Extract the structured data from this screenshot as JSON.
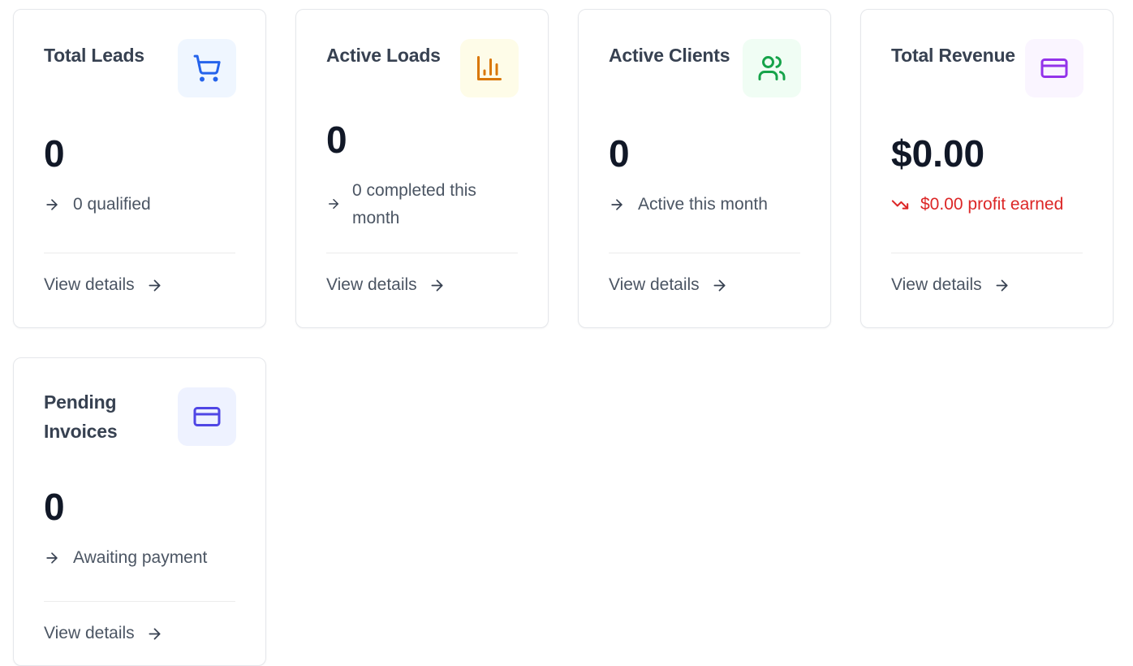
{
  "cards": {
    "total_leads": {
      "title": "Total Leads",
      "value": "0",
      "subtitle": "0 qualified",
      "link": "View details",
      "icon": "cart-icon",
      "icon_bg": "#eff6ff",
      "icon_color": "#2563eb"
    },
    "active_loads": {
      "title": "Active Loads",
      "value": "0",
      "subtitle_line1": "0 completed this",
      "subtitle_line2": "month",
      "link": "View details",
      "icon": "bar-chart-icon",
      "icon_bg": "#fefce8",
      "icon_color": "#d97706"
    },
    "active_clients": {
      "title": "Active Clients",
      "value": "0",
      "subtitle": "Active this month",
      "link": "View details",
      "icon": "users-icon",
      "icon_bg": "#f0fdf4",
      "icon_color": "#16a34a"
    },
    "total_revenue": {
      "title": "Total Revenue",
      "value": "$0.00",
      "subtitle": "$0.00 profit earned",
      "link": "View details",
      "icon": "credit-card-icon",
      "icon_bg": "#faf5ff",
      "icon_color": "#9333ea",
      "trend_icon": "trending-down-icon",
      "trend_color": "#dc2626"
    },
    "pending_invoices": {
      "title_line1": "Pending",
      "title_line2": "Invoices",
      "value": "0",
      "subtitle": "Awaiting payment",
      "link": "View details",
      "icon": "credit-card-icon",
      "icon_bg": "#eef2ff",
      "icon_color": "#4f46e5"
    }
  }
}
